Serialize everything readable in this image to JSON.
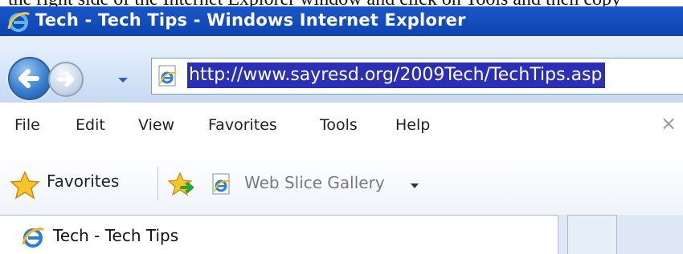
{
  "window": {
    "title": "Tech - Tech Tips - Windows Internet Explorer",
    "caption_above": "the right side of the Internet Explorer window and click on Tools and then copy"
  },
  "address": {
    "url": "http://www.sayresd.org/2009Tech/TechTips.asp",
    "selection_color": "#2b2fb5"
  },
  "menu": {
    "items": [
      "File",
      "Edit",
      "View",
      "Favorites",
      "Tools",
      "Help"
    ],
    "close_glyph": "×"
  },
  "favorites_bar": {
    "favorites_label": "Favorites",
    "web_slice_label": "Web Slice Gallery"
  },
  "tabs": {
    "active_label": "Tech - Tech Tips"
  },
  "icons": {
    "app": "ie-icon",
    "back": "back-arrow-icon",
    "forward": "forward-arrow-icon",
    "favorites": "star-icon",
    "add_favorites": "add-to-favorites-icon",
    "page": "ie-page-icon"
  }
}
